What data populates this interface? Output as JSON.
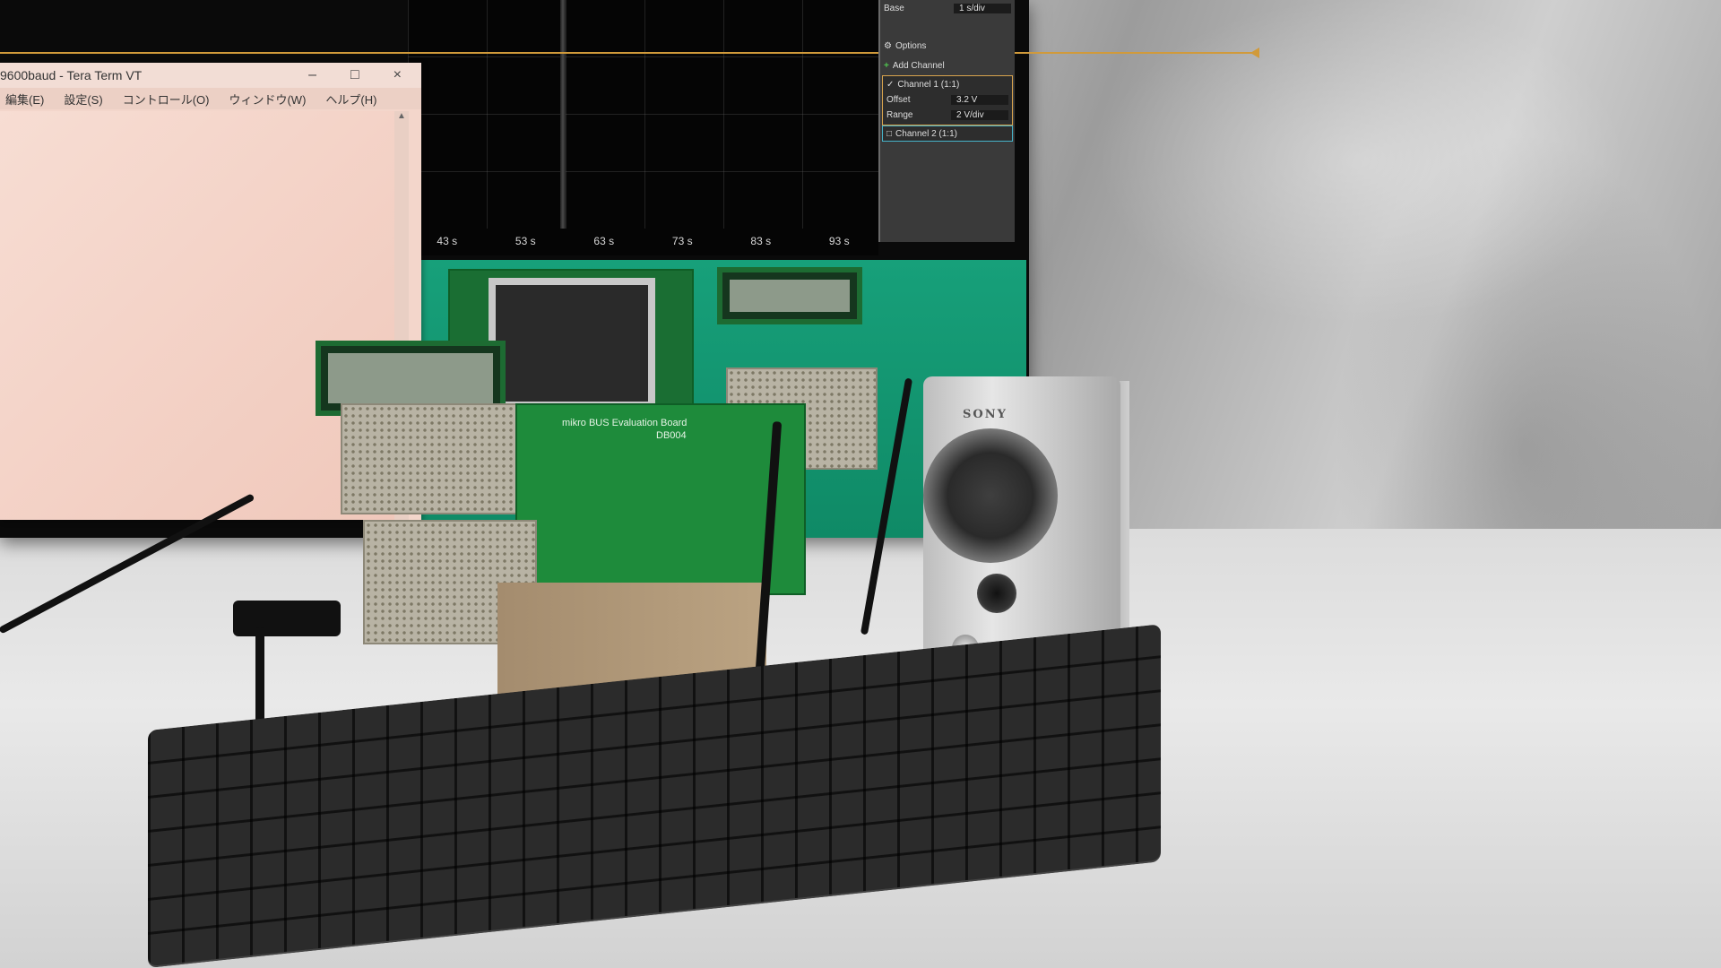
{
  "scene": "photo",
  "tera_term": {
    "title": "9600baud - Tera Term VT",
    "menu": [
      "編集(E)",
      "設定(S)",
      "コントロール(O)",
      "ウィンドウ(W)",
      "ヘルプ(H)"
    ],
    "controls": [
      "–",
      "□",
      "×"
    ]
  },
  "oscilloscope": {
    "x_ticks": [
      "43 s",
      "53 s",
      "63 s",
      "73 s",
      "83 s",
      "93 s"
    ],
    "panel": {
      "base_label": "Base",
      "base_value": "1 s/div",
      "options_label": "Options",
      "add_channel_label": "Add Channel",
      "channel1_label": "Channel 1 (1:1)",
      "offset_label": "Offset",
      "offset_value": "3.2 V",
      "range_label": "Range",
      "range_value": "2 V/div",
      "channel2_label": "Channel 2 (1:1)"
    },
    "colors": {
      "trace": "#d19a3a",
      "channel1": "#d8a34d",
      "channel2": "#46b3c9"
    }
  },
  "hardware": {
    "board_label_line1": "mikro BUS Evaluation Board",
    "board_label_line2": "DB004",
    "speaker_brand": "SONY"
  }
}
